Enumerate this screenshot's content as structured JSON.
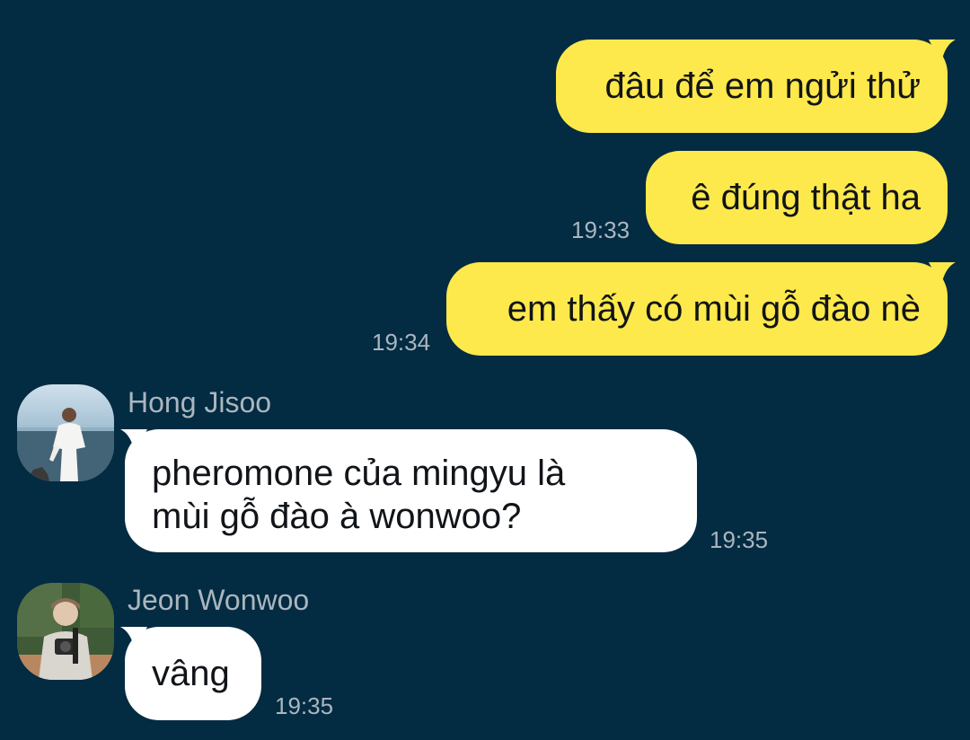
{
  "messages": [
    {
      "from": "me",
      "text": "đâu để em ngửi thử",
      "time": ""
    },
    {
      "from": "me",
      "text": "ê đúng thật ha",
      "time": "19:33"
    },
    {
      "from": "me",
      "text": "em thấy có mùi gỗ đào nè",
      "time": "19:34"
    },
    {
      "from": "Hong Jisoo",
      "line1": "pheromone của mingyu là",
      "line2": "mùi gỗ đào à wonwoo?",
      "time": "19:35",
      "avatar_icon": "man-by-sea-avatar"
    },
    {
      "from": "Jeon Wonwoo",
      "text": "vâng",
      "time": "19:35",
      "avatar_icon": "man-with-camera-avatar"
    }
  ],
  "colors": {
    "background": "#032b42",
    "my_bubble": "#fde94b",
    "their_bubble": "#ffffff",
    "meta_text": "#aab6bf"
  }
}
